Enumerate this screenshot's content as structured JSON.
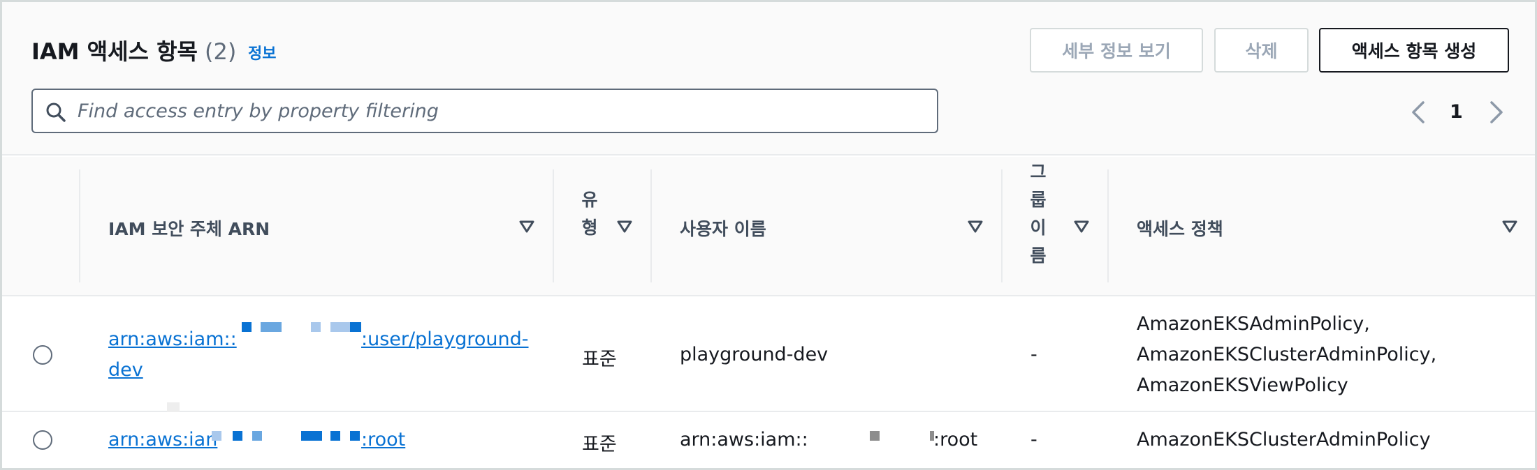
{
  "header": {
    "title": "IAM 액세스 항목",
    "count": "(2)",
    "info_link": "정보"
  },
  "actions": {
    "details": "세부 정보 보기",
    "delete": "삭제",
    "create": "액세스 항목 생성"
  },
  "search": {
    "placeholder": "Find access entry by property filtering"
  },
  "pagination": {
    "current_page": "1"
  },
  "columns": {
    "arn": "IAM 보안 주체 ARN",
    "type": [
      "유",
      "형"
    ],
    "username": "사용자 이름",
    "group": [
      "그",
      "룹",
      "이",
      "름"
    ],
    "policy": "액세스 정책"
  },
  "rows": [
    {
      "arn_prefix": "arn:aws:iam::",
      "arn_suffix": ":user/playground-",
      "arn_suffix_line2": "dev",
      "type": "표준",
      "username": "playground-dev",
      "group": "-",
      "policies": [
        "AmazonEKSAdminPolicy,",
        "AmazonEKSClusterAdminPolicy,",
        "AmazonEKSViewPolicy"
      ]
    },
    {
      "arn_prefix": "arn:aws:ian",
      "arn_suffix": ":root",
      "type": "표준",
      "username_prefix": "arn:aws:iam::",
      "username_suffix": ":root",
      "group": "-",
      "policy": "AmazonEKSClusterAdminPolicy"
    }
  ],
  "icons": {
    "search": "search-icon",
    "prev": "chevron-left-icon",
    "next": "chevron-right-icon",
    "sort": "sort-caret-down-icon"
  },
  "colors": {
    "link": "#0972d3",
    "text": "#16191f",
    "disabled": "#9ba7b6",
    "header_bg": "#fafafa"
  }
}
